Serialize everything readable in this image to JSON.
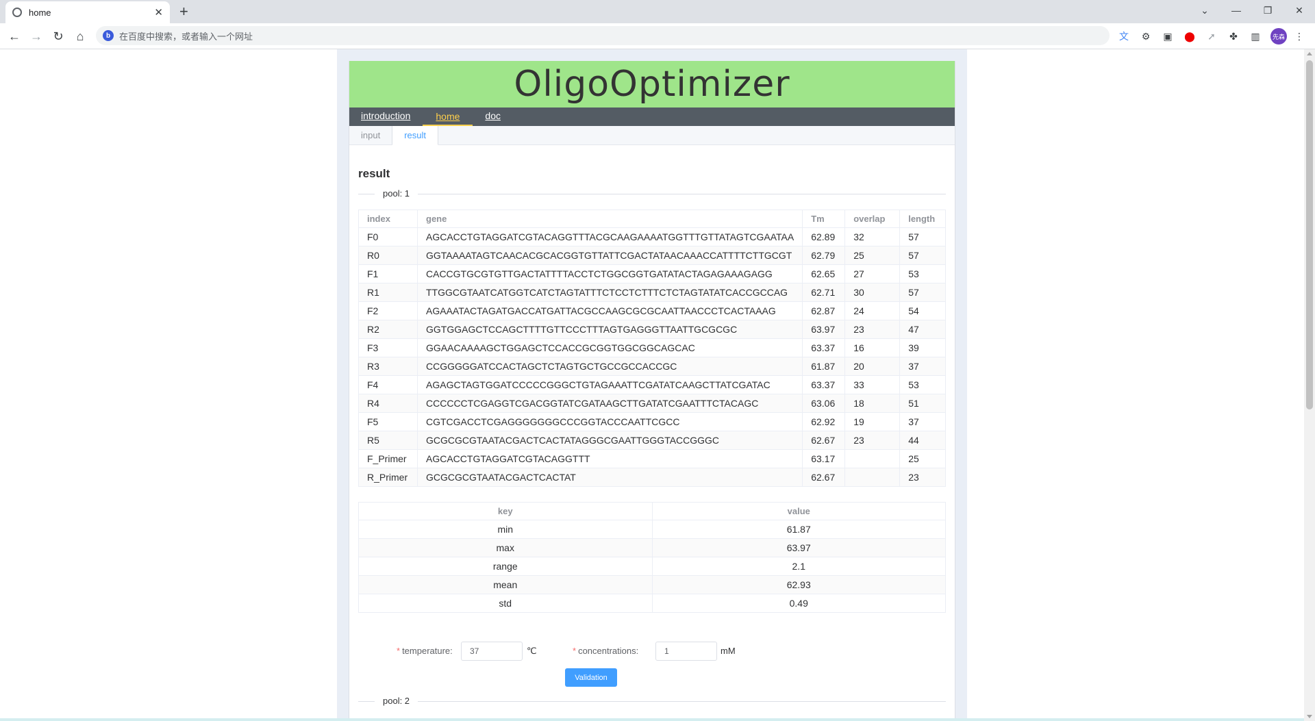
{
  "browser": {
    "tab_title": "home",
    "omnibox_placeholder": "在百度中搜索，或者输入一个网址",
    "profile_label": "先森"
  },
  "app": {
    "title": "OligoOptimizer",
    "nav": [
      {
        "label": "introduction"
      },
      {
        "label": "home"
      },
      {
        "label": "doc"
      }
    ],
    "subtabs": [
      {
        "label": "input"
      },
      {
        "label": "result"
      }
    ]
  },
  "result": {
    "heading": "result",
    "pool1_label": "pool: 1",
    "pool2_label": "pool: 2",
    "oligo_table": {
      "columns": [
        "index",
        "gene",
        "Tm",
        "overlap",
        "length"
      ],
      "rows": [
        [
          "F0",
          "AGCACCTGTAGGATCGTACAGGTTTACGCAAGAAAATGGTTTGTTATAGTCGAATAA",
          "62.89",
          "32",
          "57"
        ],
        [
          "R0",
          "GGTAAAATAGTCAACACGCACGGTGTTATTCGACTATAACAAACCATTTTCTTGCGT",
          "62.79",
          "25",
          "57"
        ],
        [
          "F1",
          "CACCGTGCGTGTTGACTATTTTACCTCTGGCGGTGATATACTAGAGAAAGAGG",
          "62.65",
          "27",
          "53"
        ],
        [
          "R1",
          "TTGGCGTAATCATGGTCATCTAGTATTTCTCCTCTTTCTCTAGTATATCACCGCCAG",
          "62.71",
          "30",
          "57"
        ],
        [
          "F2",
          "AGAAATACTAGATGACCATGATTACGCCAAGCGCGCAATTAACCCTCACTAAAG",
          "62.87",
          "24",
          "54"
        ],
        [
          "R2",
          "GGTGGAGCTCCAGCTTTTGTTCCCTTTAGTGAGGGTTAATTGCGCGC",
          "63.97",
          "23",
          "47"
        ],
        [
          "F3",
          "GGAACAAAAGCTGGAGCTCCACCGCGGTGGCGGCAGCAC",
          "63.37",
          "16",
          "39"
        ],
        [
          "R3",
          "CCGGGGGATCCACTAGCTCTAGTGCTGCCGCCACCGC",
          "61.87",
          "20",
          "37"
        ],
        [
          "F4",
          "AGAGCTAGTGGATCCCCCGGGCTGTAGAAATTCGATATCAAGCTTATCGATAC",
          "63.37",
          "33",
          "53"
        ],
        [
          "R4",
          "CCCCCCTCGAGGTCGACGGTATCGATAAGCTTGATATCGAATTTCTACAGC",
          "63.06",
          "18",
          "51"
        ],
        [
          "F5",
          "CGTCGACCTCGAGGGGGGGCCCGGTACCCAATTCGCC",
          "62.92",
          "19",
          "37"
        ],
        [
          "R5",
          "GCGCGCGTAATACGACTCACTATAGGGCGAATTGGGTACCGGGC",
          "62.67",
          "23",
          "44"
        ],
        [
          "F_Primer",
          "AGCACCTGTAGGATCGTACAGGTTT",
          "63.17",
          "",
          "25"
        ],
        [
          "R_Primer",
          "GCGCGCGTAATACGACTCACTAT",
          "62.67",
          "",
          "23"
        ]
      ]
    },
    "stats_table": {
      "columns": [
        "key",
        "value"
      ],
      "rows": [
        [
          "min",
          "61.87"
        ],
        [
          "max",
          "63.97"
        ],
        [
          "range",
          "2.1"
        ],
        [
          "mean",
          "62.93"
        ],
        [
          "std",
          "0.49"
        ]
      ]
    },
    "form": {
      "temperature_label": "temperature:",
      "temperature_value": "37",
      "temperature_unit": "℃",
      "concentrations_label": "concentrations:",
      "concentrations_value": "1",
      "concentrations_unit": "mM",
      "required_mark": "*",
      "validate_label": "Validation"
    }
  },
  "colors": {
    "header_bg": "#9fe58a",
    "nav_bg": "#545c64",
    "nav_active": "#ffd04b",
    "accent": "#409eff"
  }
}
